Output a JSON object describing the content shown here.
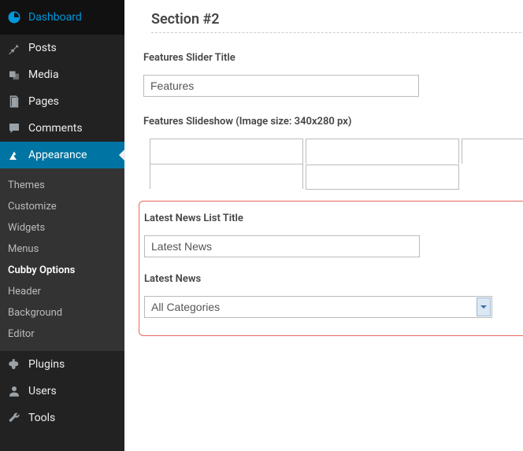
{
  "sidebar": {
    "dashboard": "Dashboard",
    "posts": "Posts",
    "media": "Media",
    "pages": "Pages",
    "comments": "Comments",
    "appearance": "Appearance",
    "plugins": "Plugins",
    "users": "Users",
    "tools": "Tools",
    "submenu": {
      "themes": "Themes",
      "customize": "Customize",
      "widgets": "Widgets",
      "menus": "Menus",
      "cubby_options": "Cubby Options",
      "header": "Header",
      "background": "Background",
      "editor": "Editor"
    }
  },
  "main": {
    "section_title": "Section #2",
    "features_slider_label": "Features Slider Title",
    "features_slider_value": "Features",
    "slideshow_label": "Features Slideshow (Image size: 340x280 px)",
    "slideshow_rows": [
      "",
      "",
      "",
      "",
      ""
    ],
    "latest_news_title_label": "Latest News List Title",
    "latest_news_title_value": "Latest News",
    "latest_news_label": "Latest News",
    "latest_news_select_value": "All Categories"
  }
}
